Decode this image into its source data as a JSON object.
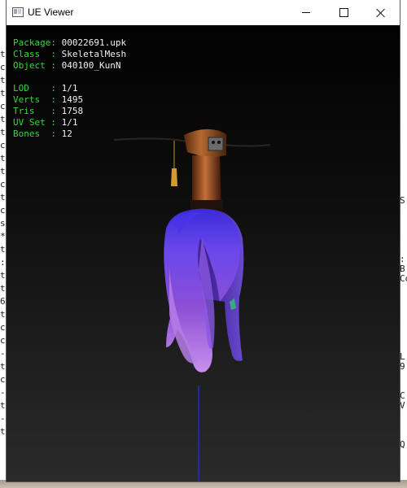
{
  "window": {
    "title": "UE Viewer"
  },
  "info": {
    "rows1": [
      {
        "label": "Package",
        "value": "00022691.upk"
      },
      {
        "label": "Class  ",
        "value": "SkeletalMesh"
      },
      {
        "label": "Object ",
        "value": "040100_KunN"
      }
    ],
    "rows2": [
      {
        "label": "LOD    ",
        "value": "1/1"
      },
      {
        "label": "Verts  ",
        "value": "1495"
      },
      {
        "label": "Tris   ",
        "value": "1758"
      },
      {
        "label": "UV Set ",
        "value": "1/1"
      },
      {
        "label": "Bones  ",
        "value": "12"
      }
    ]
  },
  "background_console": {
    "left_chars": [
      "t",
      "c",
      "t",
      "t",
      "c",
      "t",
      "t",
      "c",
      "t",
      "t",
      "c",
      "t",
      "c",
      "s",
      "*",
      "t",
      ":",
      "t",
      "t",
      "6",
      "t",
      "c",
      "c",
      "-",
      "t",
      "c",
      "-",
      "t",
      "-",
      "t"
    ],
    "right_chars": [
      "",
      "",
      "",
      "",
      "",
      "",
      "",
      "",
      "",
      "",
      "",
      "",
      "",
      "",
      "",
      "S",
      "",
      "",
      "",
      "",
      "",
      ":",
      "B",
      "Co",
      "",
      "",
      "",
      "",
      "",
      "",
      "",
      "L",
      "9",
      "",
      "",
      "C",
      "V",
      "",
      "",
      "",
      "Q",
      "",
      "",
      "",
      ""
    ]
  },
  "colors": {
    "info_label": "#35d838",
    "info_value": "#f2f2f2",
    "hair_top": "#5c3df0",
    "hair_mid": "#9a56e0",
    "hair_tip": "#c58be8",
    "axis": "#1b2fc8",
    "hat_wood": "#9a5222"
  }
}
